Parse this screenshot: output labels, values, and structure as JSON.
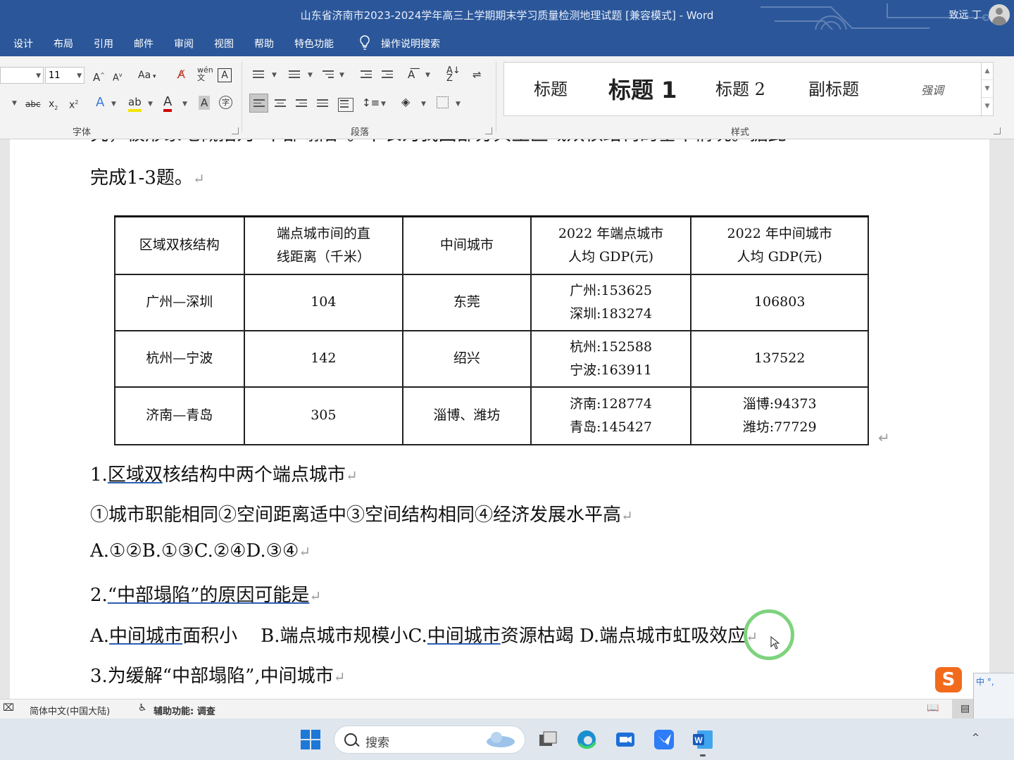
{
  "window": {
    "title": "山东省济南市2023-2024学年高三上学期期末学习质量检测地理试题 [兼容模式]  -  Word",
    "user": "致远 丁"
  },
  "menu": [
    "设计",
    "布局",
    "引用",
    "邮件",
    "审阅",
    "视图",
    "帮助",
    "特色功能",
    "操作说明搜索"
  ],
  "ribbon": {
    "font_size": "11",
    "groups": {
      "font": "字体",
      "paragraph": "段落",
      "styles": "样式"
    },
    "styles": [
      "标题",
      "标题 1",
      "标题 2",
      "副标题",
      "强调"
    ]
  },
  "document": {
    "partial_line": "究，被形象地概括为“中部塌陷”。下表为我国部分典型区域双核结构的基本情况。据此",
    "line_intro": "完成1-3题。",
    "table": {
      "headers": [
        "区域双核结构",
        "端点城市间的直线距离（千米）",
        "中间城市",
        "2022 年端点城市人均 GDP(元)",
        "2022 年中间城市人均 GDP(元)"
      ],
      "headers_lines": [
        [
          "区域双核结构"
        ],
        [
          "端点城市间的直",
          "线距离（千米）"
        ],
        [
          "中间城市"
        ],
        [
          "2022 年端点城市",
          "人均 GDP(元)"
        ],
        [
          "2022 年中间城市",
          "人均 GDP(元)"
        ]
      ],
      "rows": [
        {
          "pair": "广州—深圳",
          "distance": "104",
          "middle": "东莞",
          "end_gdp": [
            "广州:153625",
            "深圳:183274"
          ],
          "mid_gdp": [
            "106803"
          ]
        },
        {
          "pair": "杭州—宁波",
          "distance": "142",
          "middle": "绍兴",
          "end_gdp": [
            "杭州:152588",
            "宁波:163911"
          ],
          "mid_gdp": [
            "137522"
          ]
        },
        {
          "pair": "济南—青岛",
          "distance": "305",
          "middle": "淄博、潍坊",
          "end_gdp": [
            "济南:128774",
            "青岛:145427"
          ],
          "mid_gdp": [
            "淄博:94373",
            "潍坊:77729"
          ]
        }
      ]
    },
    "q1": {
      "num": "1.",
      "u": "区域双",
      "rest": "核结构中两个端点城市"
    },
    "q1_items": "①城市职能相同②空间距离适中③空间结构相同④经济发展水平高",
    "q1_options": "A.①②B.①③C.②④D.③④",
    "q2": {
      "num": "2.",
      "u": "“中部塌陷”的原因可能是"
    },
    "q2_options": {
      "a_pre": "A.",
      "a_u": "中间城市",
      "a_rest": "面积小    B.端点城市规模小C.",
      "c_u": "中间城市",
      "c_rest": "资源枯竭 D.端点城市虹吸效应"
    },
    "q3": "3.为缓解“中部塌陷”,中间城市",
    "paragraph_mark": "↵"
  },
  "status": {
    "language": "简体中文(中国大陆)",
    "accessibility": "辅助功能: 调查"
  },
  "taskbar": {
    "search": "搜索"
  }
}
